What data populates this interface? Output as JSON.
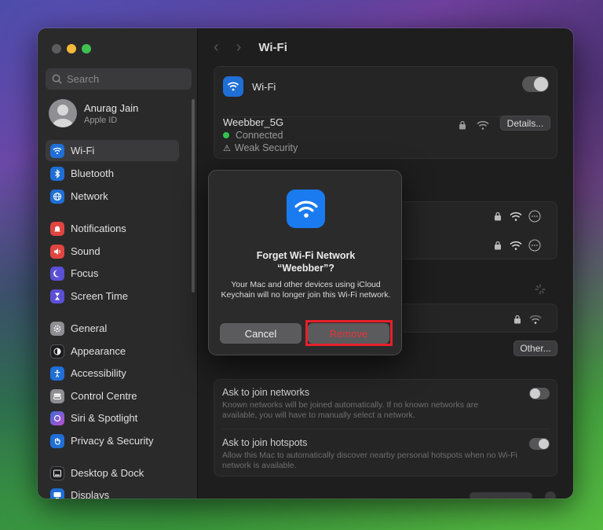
{
  "window": {
    "title": "Wi-Fi",
    "colors": {
      "accent": "#1a7bf0",
      "danger": "#e8333a",
      "connected": "#32c24d",
      "highlight": "#e8202a"
    }
  },
  "sidebar": {
    "search_placeholder": "Search",
    "account": {
      "name": "Anurag Jain",
      "subtitle": "Apple ID"
    },
    "items": [
      {
        "label": "Wi-Fi",
        "icon": "wifi-icon",
        "color": "#1f6fd6"
      },
      {
        "label": "Bluetooth",
        "icon": "bluetooth-icon",
        "color": "#1f6fd6"
      },
      {
        "label": "Network",
        "icon": "globe-icon",
        "color": "#1f6fd6"
      },
      {
        "label": "Notifications",
        "icon": "bell-icon",
        "color": "#e0453f"
      },
      {
        "label": "Sound",
        "icon": "speaker-icon",
        "color": "#e0453f"
      },
      {
        "label": "Focus",
        "icon": "moon-icon",
        "color": "#5b4fd6"
      },
      {
        "label": "Screen Time",
        "icon": "hourglass-icon",
        "color": "#5b4fd6"
      },
      {
        "label": "General",
        "icon": "gear-icon",
        "color": "#8e8e93"
      },
      {
        "label": "Appearance",
        "icon": "appearance-icon",
        "color": "#1c1c1e"
      },
      {
        "label": "Accessibility",
        "icon": "accessibility-icon",
        "color": "#1f6fd6"
      },
      {
        "label": "Control Centre",
        "icon": "control-centre-icon",
        "color": "#8e8e93"
      },
      {
        "label": "Siri & Spotlight",
        "icon": "siri-icon",
        "color": "#6a4cd6"
      },
      {
        "label": "Privacy & Security",
        "icon": "hand-icon",
        "color": "#1f6fd6"
      },
      {
        "label": "Desktop & Dock",
        "icon": "dock-icon",
        "color": "#1c1c1e"
      },
      {
        "label": "Displays",
        "icon": "display-icon",
        "color": "#1f6fd6"
      }
    ]
  },
  "wifi_card": {
    "label": "Wi-Fi",
    "network_name": "Weebber_5G",
    "status": "Connected",
    "warning": "Weak Security",
    "details_button": "Details..."
  },
  "other_button": "Other...",
  "settings": {
    "ask_join_networks": {
      "title": "Ask to join networks",
      "description": "Known networks will be joined automatically. If no known networks are available, you will have to manually select a network."
    },
    "ask_join_hotspots": {
      "title": "Ask to join hotspots",
      "description": "Allow this Mac to automatically discover nearby personal hotspots when no Wi-Fi network is available."
    }
  },
  "dialog": {
    "title_line1": "Forget Wi-Fi Network",
    "title_line2": "“Weebber”?",
    "body": "Your Mac and other devices using iCloud Keychain will no longer join this Wi-Fi network.",
    "cancel_label": "Cancel",
    "remove_label": "Remove"
  }
}
